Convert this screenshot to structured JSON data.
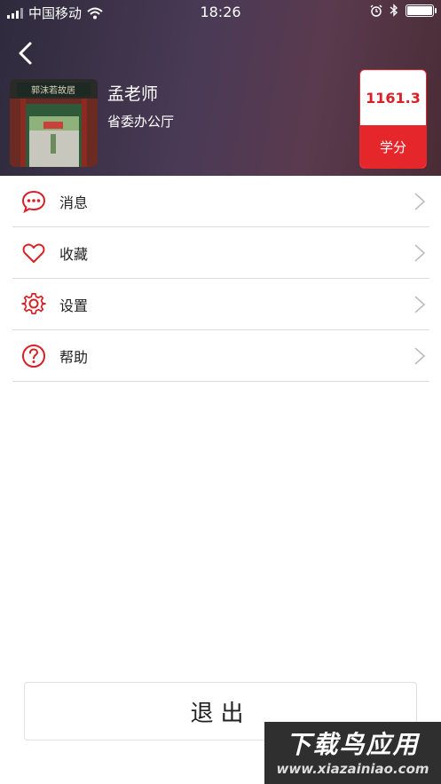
{
  "status_bar": {
    "carrier": "中国移动",
    "time": "18:26"
  },
  "profile": {
    "name": "孟老师",
    "department": "省委办公厅"
  },
  "score": {
    "value": "1161.3",
    "label": "学分"
  },
  "menu": [
    {
      "label": "消息",
      "icon": "message-icon"
    },
    {
      "label": "收藏",
      "icon": "heart-icon"
    },
    {
      "label": "设置",
      "icon": "gear-icon"
    },
    {
      "label": "帮助",
      "icon": "help-icon"
    }
  ],
  "logout_label": "退出",
  "watermark": {
    "title": "下载鸟应用",
    "url": "www.xiazainiao.com"
  },
  "colors": {
    "accent": "#e5262b",
    "header": "#4a3a56"
  }
}
